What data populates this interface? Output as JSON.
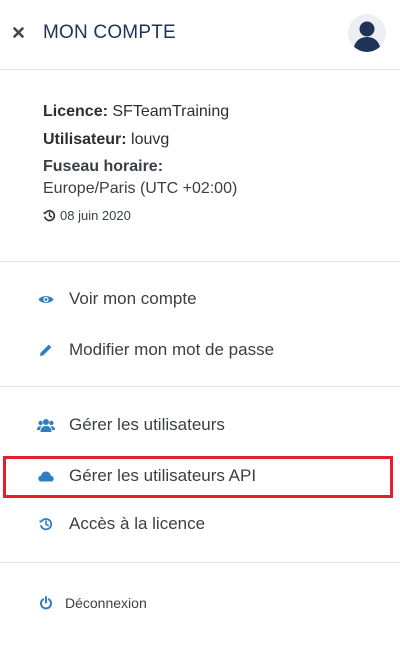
{
  "header": {
    "title": "MON COMPTE",
    "close_icon": "close-icon",
    "avatar_icon": "user-avatar-icon"
  },
  "account": {
    "licence_label": "Licence:",
    "licence_value": "SFTeamTraining",
    "user_label": "Utilisateur:",
    "user_value": "louvg",
    "timezone_label": "Fuseau horaire:",
    "timezone_value": "Europe/Paris (UTC +02:00)",
    "date": "08 juin 2020",
    "date_icon": "history-icon"
  },
  "menu": {
    "view_account": {
      "label": "Voir mon compte",
      "icon": "eye-icon"
    },
    "change_password": {
      "label": "Modifier mon mot de passe",
      "icon": "pencil-icon"
    },
    "manage_users": {
      "label": "Gérer les utilisateurs",
      "icon": "users-icon"
    },
    "manage_api_users": {
      "label": "Gérer les utilisateurs API",
      "icon": "cloud-icon"
    },
    "licence_access": {
      "label": "Accès à la licence",
      "icon": "history-icon"
    },
    "logout": {
      "label": "Déconnexion",
      "icon": "power-icon"
    }
  },
  "colors": {
    "accent": "#2e7fc1",
    "title": "#1f3358",
    "highlight": "#e21f2c"
  }
}
